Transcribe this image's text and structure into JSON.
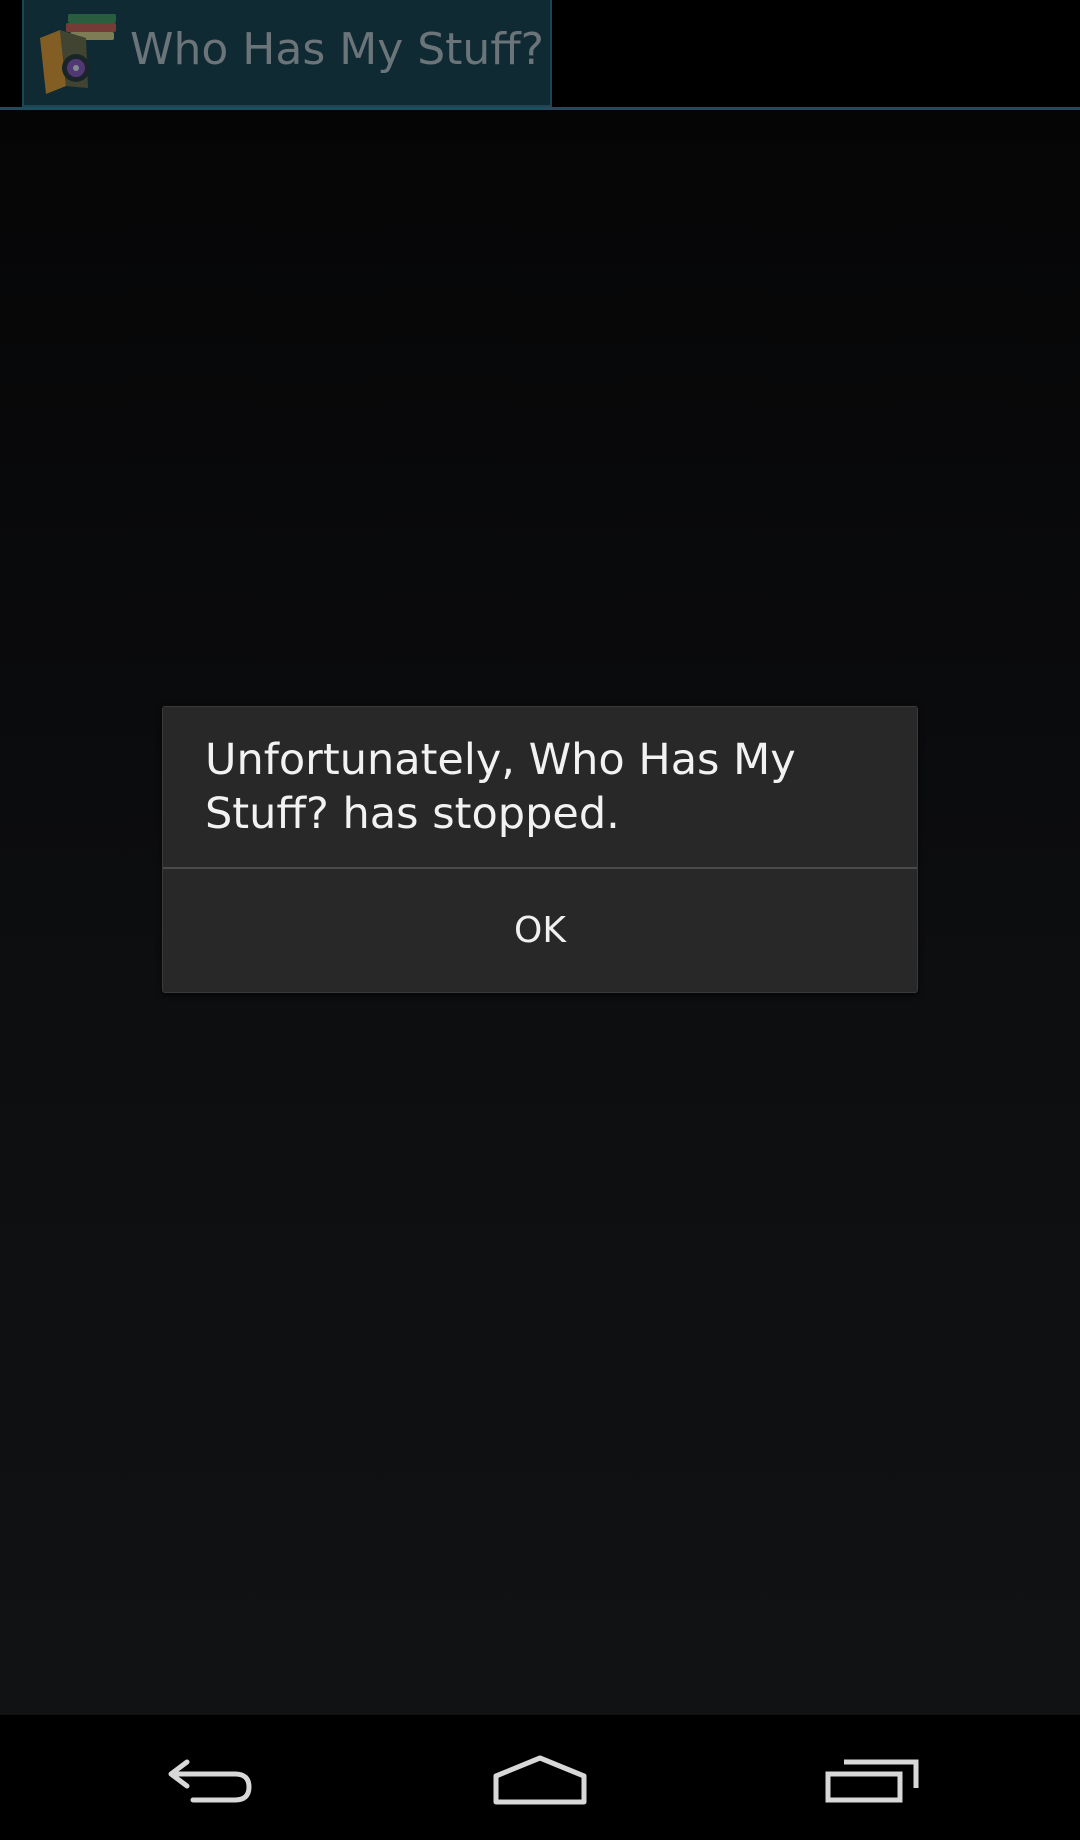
{
  "action_bar": {
    "title": "Who Has My Stuff?",
    "icon": "app-books-icon"
  },
  "dialog": {
    "message": "Unfortunately, Who Has My Stuff? has stopped.",
    "ok_label": "OK"
  },
  "nav_bar": {
    "back_icon": "back-icon",
    "home_icon": "home-icon",
    "recents_icon": "recents-icon"
  },
  "colors": {
    "accent": "#1f4d5c",
    "dialog_bg": "#282828"
  }
}
